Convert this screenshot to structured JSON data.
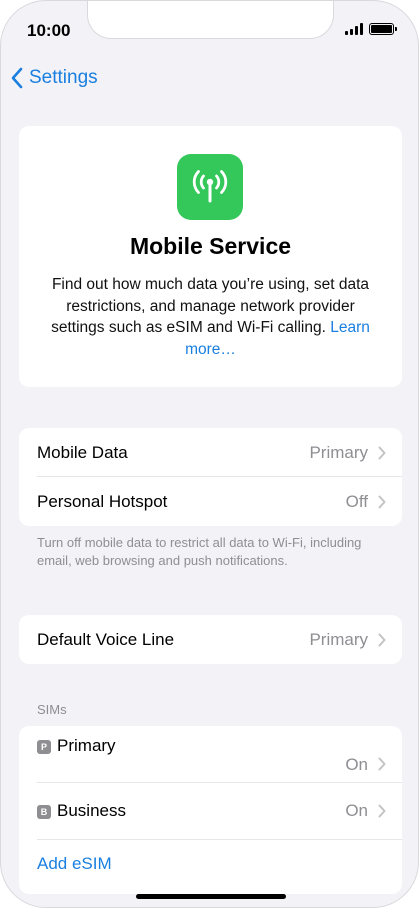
{
  "status_bar": {
    "time": "10:00"
  },
  "nav": {
    "back_label": "Settings"
  },
  "hero": {
    "title": "Mobile Service",
    "description": "Find out how much data you’re using, set data restrictions, and manage network provider settings such as eSIM and Wi-Fi calling.",
    "link": "Learn more…",
    "icon": "antenna-icon",
    "icon_color": "#34c759"
  },
  "data_group": [
    {
      "label": "Mobile Data",
      "value": "Primary"
    },
    {
      "label": "Personal Hotspot",
      "value": "Off"
    }
  ],
  "footnote": "Turn off mobile data to restrict all data to Wi-Fi, including email, web browsing and push notifications.",
  "voice_group": [
    {
      "label": "Default Voice Line",
      "value": "Primary"
    }
  ],
  "sims": {
    "header": "SIMs",
    "items": [
      {
        "badge": "P",
        "label": "Primary",
        "value": "On"
      },
      {
        "badge": "B",
        "label": "Business",
        "value": "On"
      }
    ],
    "add_label": "Add eSIM"
  },
  "colors": {
    "accent": "#1a7fe0",
    "background": "#f2f2f7",
    "secondary_text": "#8e8e93"
  }
}
